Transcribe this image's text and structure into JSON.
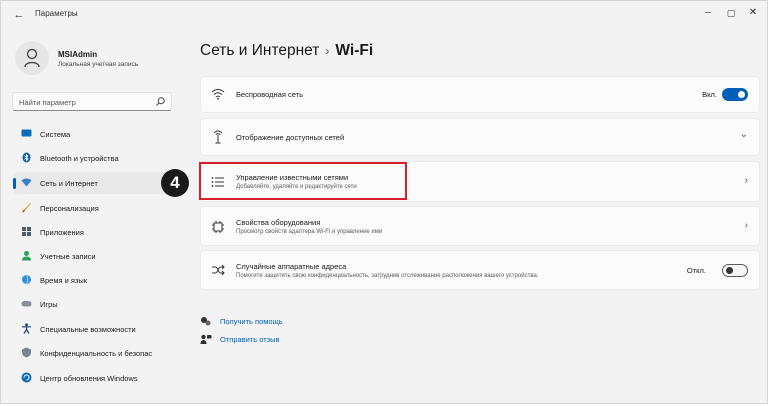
{
  "window": {
    "title": "Параметры",
    "back_glyph": "←",
    "minimize_glyph": "–",
    "maximize_glyph": "▢",
    "close_glyph": "✕"
  },
  "profile": {
    "name": "MSIAdmin",
    "subtitle": "Локальная учетная запись"
  },
  "search": {
    "placeholder": "Найти параметр"
  },
  "sidebar": {
    "items": [
      {
        "label": "Система",
        "icon": "monitor-icon",
        "active": false
      },
      {
        "label": "Bluetooth и устройства",
        "icon": "bluetooth-icon",
        "active": false
      },
      {
        "label": "Сеть и Интернет",
        "icon": "wifi-icon",
        "active": true
      },
      {
        "label": "Персонализация",
        "icon": "brush-icon",
        "active": false
      },
      {
        "label": "Приложения",
        "icon": "apps-icon",
        "active": false
      },
      {
        "label": "Учетные записи",
        "icon": "user-icon",
        "active": false
      },
      {
        "label": "Время и язык",
        "icon": "globe-clock-icon",
        "active": false
      },
      {
        "label": "Игры",
        "icon": "gamepad-icon",
        "active": false
      },
      {
        "label": "Специальные возможности",
        "icon": "accessibility-icon",
        "active": false
      },
      {
        "label": "Конфиденциальность и безопас",
        "icon": "shield-icon",
        "active": false
      },
      {
        "label": "Центр обновления Windows",
        "icon": "update-icon",
        "active": false
      }
    ]
  },
  "header": {
    "parent": "Сеть и Интернет",
    "separator": "›",
    "current": "Wi-Fi"
  },
  "cards": {
    "wireless": {
      "title": "Беспроводная сеть",
      "state_label": "Вкл.",
      "on": true
    },
    "available": {
      "title": "Отображение доступных сетей",
      "chevron": "⌄"
    },
    "known": {
      "title": "Управление известными сетями",
      "subtitle": "Добавляйте, удаляйте и редактируйте сети",
      "chevron": "›"
    },
    "hardware": {
      "title": "Свойства оборудования",
      "subtitle": "Просмотр свойств адаптера Wi-Fi и управление ими",
      "chevron": "›"
    },
    "random_mac": {
      "title": "Случайные аппаратные адреса",
      "subtitle": "Помогите защитить свою конфиденциальность, затруднив отслеживание расположения вашего устройства.",
      "state_label": "Откл.",
      "on": false
    }
  },
  "annotation": {
    "step_number": "4",
    "highlight_color": "#d81e28"
  },
  "links": {
    "help": "Получить помощь",
    "feedback": "Отправить отзыв"
  },
  "colors": {
    "accent": "#005fb8",
    "window_bg": "#f3f3f3",
    "card_bg": "#fbfbfb"
  }
}
